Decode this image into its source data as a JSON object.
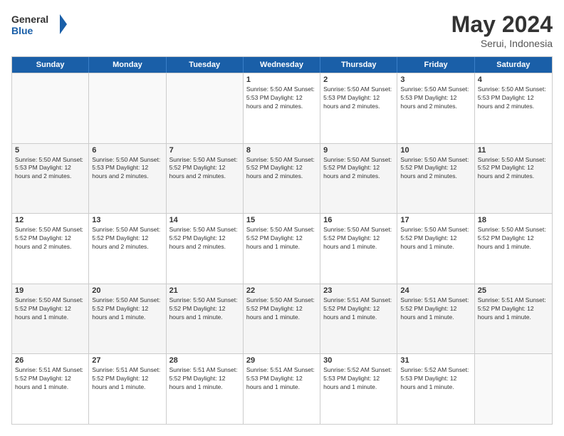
{
  "logo": {
    "line1": "General",
    "line2": "Blue"
  },
  "title": {
    "month": "May 2024",
    "location": "Serui, Indonesia"
  },
  "header": {
    "days": [
      "Sunday",
      "Monday",
      "Tuesday",
      "Wednesday",
      "Thursday",
      "Friday",
      "Saturday"
    ]
  },
  "weeks": [
    [
      {
        "day": "",
        "info": ""
      },
      {
        "day": "",
        "info": ""
      },
      {
        "day": "",
        "info": ""
      },
      {
        "day": "1",
        "info": "Sunrise: 5:50 AM\nSunset: 5:53 PM\nDaylight: 12 hours\nand 2 minutes."
      },
      {
        "day": "2",
        "info": "Sunrise: 5:50 AM\nSunset: 5:53 PM\nDaylight: 12 hours\nand 2 minutes."
      },
      {
        "day": "3",
        "info": "Sunrise: 5:50 AM\nSunset: 5:53 PM\nDaylight: 12 hours\nand 2 minutes."
      },
      {
        "day": "4",
        "info": "Sunrise: 5:50 AM\nSunset: 5:53 PM\nDaylight: 12 hours\nand 2 minutes."
      }
    ],
    [
      {
        "day": "5",
        "info": "Sunrise: 5:50 AM\nSunset: 5:53 PM\nDaylight: 12 hours\nand 2 minutes."
      },
      {
        "day": "6",
        "info": "Sunrise: 5:50 AM\nSunset: 5:53 PM\nDaylight: 12 hours\nand 2 minutes."
      },
      {
        "day": "7",
        "info": "Sunrise: 5:50 AM\nSunset: 5:52 PM\nDaylight: 12 hours\nand 2 minutes."
      },
      {
        "day": "8",
        "info": "Sunrise: 5:50 AM\nSunset: 5:52 PM\nDaylight: 12 hours\nand 2 minutes."
      },
      {
        "day": "9",
        "info": "Sunrise: 5:50 AM\nSunset: 5:52 PM\nDaylight: 12 hours\nand 2 minutes."
      },
      {
        "day": "10",
        "info": "Sunrise: 5:50 AM\nSunset: 5:52 PM\nDaylight: 12 hours\nand 2 minutes."
      },
      {
        "day": "11",
        "info": "Sunrise: 5:50 AM\nSunset: 5:52 PM\nDaylight: 12 hours\nand 2 minutes."
      }
    ],
    [
      {
        "day": "12",
        "info": "Sunrise: 5:50 AM\nSunset: 5:52 PM\nDaylight: 12 hours\nand 2 minutes."
      },
      {
        "day": "13",
        "info": "Sunrise: 5:50 AM\nSunset: 5:52 PM\nDaylight: 12 hours\nand 2 minutes."
      },
      {
        "day": "14",
        "info": "Sunrise: 5:50 AM\nSunset: 5:52 PM\nDaylight: 12 hours\nand 2 minutes."
      },
      {
        "day": "15",
        "info": "Sunrise: 5:50 AM\nSunset: 5:52 PM\nDaylight: 12 hours\nand 1 minute."
      },
      {
        "day": "16",
        "info": "Sunrise: 5:50 AM\nSunset: 5:52 PM\nDaylight: 12 hours\nand 1 minute."
      },
      {
        "day": "17",
        "info": "Sunrise: 5:50 AM\nSunset: 5:52 PM\nDaylight: 12 hours\nand 1 minute."
      },
      {
        "day": "18",
        "info": "Sunrise: 5:50 AM\nSunset: 5:52 PM\nDaylight: 12 hours\nand 1 minute."
      }
    ],
    [
      {
        "day": "19",
        "info": "Sunrise: 5:50 AM\nSunset: 5:52 PM\nDaylight: 12 hours\nand 1 minute."
      },
      {
        "day": "20",
        "info": "Sunrise: 5:50 AM\nSunset: 5:52 PM\nDaylight: 12 hours\nand 1 minute."
      },
      {
        "day": "21",
        "info": "Sunrise: 5:50 AM\nSunset: 5:52 PM\nDaylight: 12 hours\nand 1 minute."
      },
      {
        "day": "22",
        "info": "Sunrise: 5:50 AM\nSunset: 5:52 PM\nDaylight: 12 hours\nand 1 minute."
      },
      {
        "day": "23",
        "info": "Sunrise: 5:51 AM\nSunset: 5:52 PM\nDaylight: 12 hours\nand 1 minute."
      },
      {
        "day": "24",
        "info": "Sunrise: 5:51 AM\nSunset: 5:52 PM\nDaylight: 12 hours\nand 1 minute."
      },
      {
        "day": "25",
        "info": "Sunrise: 5:51 AM\nSunset: 5:52 PM\nDaylight: 12 hours\nand 1 minute."
      }
    ],
    [
      {
        "day": "26",
        "info": "Sunrise: 5:51 AM\nSunset: 5:52 PM\nDaylight: 12 hours\nand 1 minute."
      },
      {
        "day": "27",
        "info": "Sunrise: 5:51 AM\nSunset: 5:52 PM\nDaylight: 12 hours\nand 1 minute."
      },
      {
        "day": "28",
        "info": "Sunrise: 5:51 AM\nSunset: 5:52 PM\nDaylight: 12 hours\nand 1 minute."
      },
      {
        "day": "29",
        "info": "Sunrise: 5:51 AM\nSunset: 5:53 PM\nDaylight: 12 hours\nand 1 minute."
      },
      {
        "day": "30",
        "info": "Sunrise: 5:52 AM\nSunset: 5:53 PM\nDaylight: 12 hours\nand 1 minute."
      },
      {
        "day": "31",
        "info": "Sunrise: 5:52 AM\nSunset: 5:53 PM\nDaylight: 12 hours\nand 1 minute."
      },
      {
        "day": "",
        "info": ""
      }
    ]
  ]
}
